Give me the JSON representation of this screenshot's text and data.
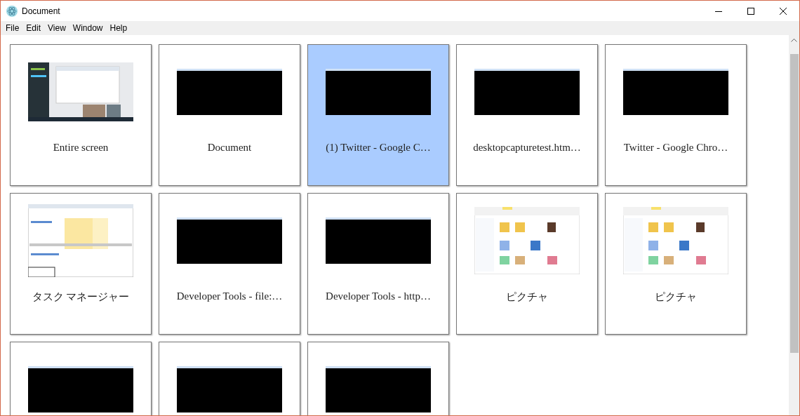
{
  "window": {
    "title": "Document"
  },
  "menu": [
    "File",
    "Edit",
    "View",
    "Window",
    "Help"
  ],
  "sources": [
    {
      "label": "Entire screen",
      "selected": false,
      "kind": "desktop"
    },
    {
      "label": "Document",
      "selected": false,
      "kind": "blank"
    },
    {
      "label": "(1) Twitter - Google C…",
      "selected": true,
      "kind": "blank"
    },
    {
      "label": "desktopcapturetest.htm…",
      "selected": false,
      "kind": "blank"
    },
    {
      "label": "Twitter - Google Chro…",
      "selected": false,
      "kind": "blank"
    },
    {
      "label": "タスク マネージャー",
      "selected": false,
      "kind": "table"
    },
    {
      "label": "Developer Tools - file:…",
      "selected": false,
      "kind": "blank"
    },
    {
      "label": "Developer Tools - http…",
      "selected": false,
      "kind": "blank"
    },
    {
      "label": "ピクチャ",
      "selected": false,
      "kind": "folder"
    },
    {
      "label": "ピクチャ",
      "selected": false,
      "kind": "folder"
    },
    {
      "selected": false,
      "kind": "blank"
    },
    {
      "selected": false,
      "kind": "blank"
    },
    {
      "selected": false,
      "kind": "blank"
    }
  ]
}
